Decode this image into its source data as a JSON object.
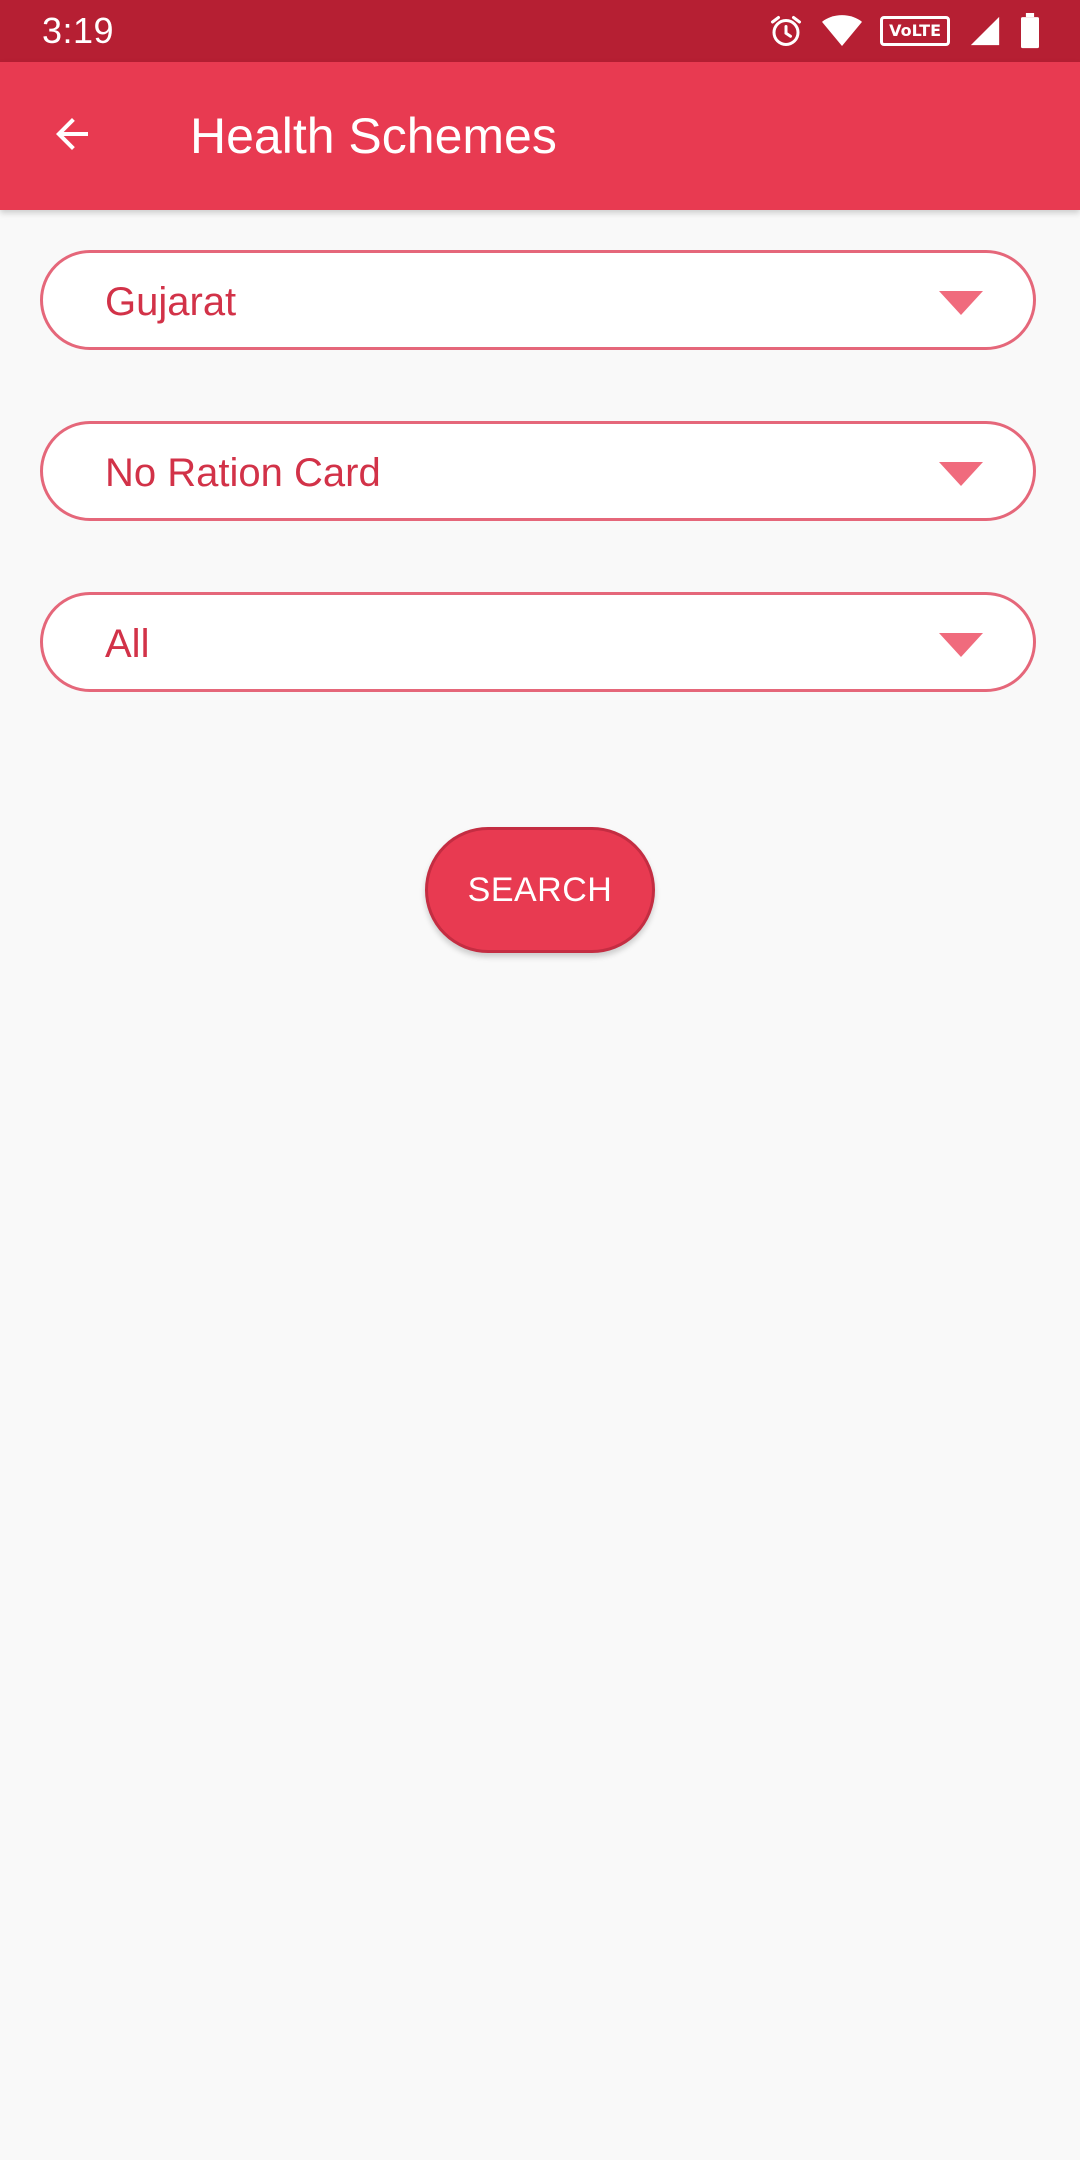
{
  "status_bar": {
    "time": "3:19",
    "network_badge": "VoLTE",
    "icons": [
      "alarm-icon",
      "wifi-icon",
      "volte-icon",
      "cell-signal-icon",
      "battery-icon"
    ]
  },
  "app_bar": {
    "title": "Health Schemes",
    "back_icon": "arrow-back-icon"
  },
  "filters": {
    "state": {
      "selected": "Gujarat"
    },
    "ration_card": {
      "selected": "No Ration Card"
    },
    "category": {
      "selected": "All"
    }
  },
  "search_button": {
    "label": "SEARCH"
  },
  "colors": {
    "status_bar": "#b61f33",
    "primary": "#e83a51",
    "dropdown_border": "#e5677a",
    "dropdown_text": "#d23248",
    "dropdown_arrow": "#f06b7d",
    "background": "#f9f9f9"
  }
}
